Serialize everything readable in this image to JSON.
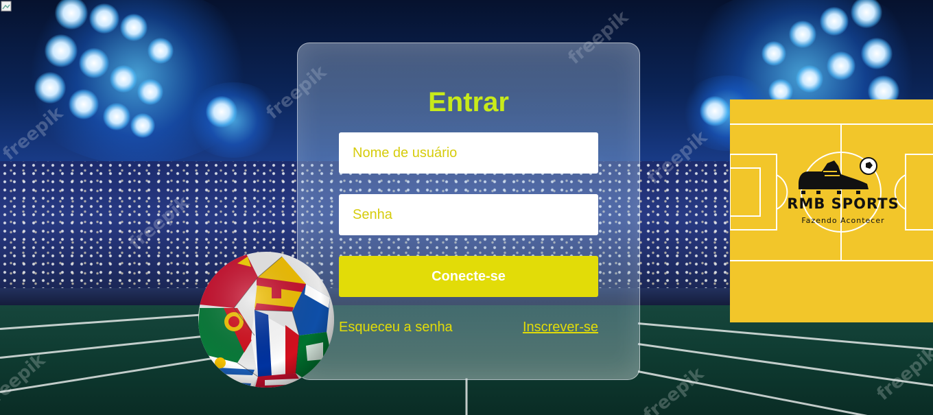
{
  "background": {
    "watermark": "freepik"
  },
  "login": {
    "title": "Entrar",
    "username_placeholder": "Nome de usuário",
    "password_placeholder": "Senha",
    "submit_label": "Conecte-se",
    "forgot_label": "Esqueceu a senha",
    "signup_label": "Inscrever-se"
  },
  "brand": {
    "name": "RMB SPORTS",
    "slogan": "Fazendo Acontecer"
  },
  "colors": {
    "accent_title": "#c8ea1a",
    "accent_yellow": "#e2dc08",
    "brand_yellow": "#f2c62a"
  }
}
